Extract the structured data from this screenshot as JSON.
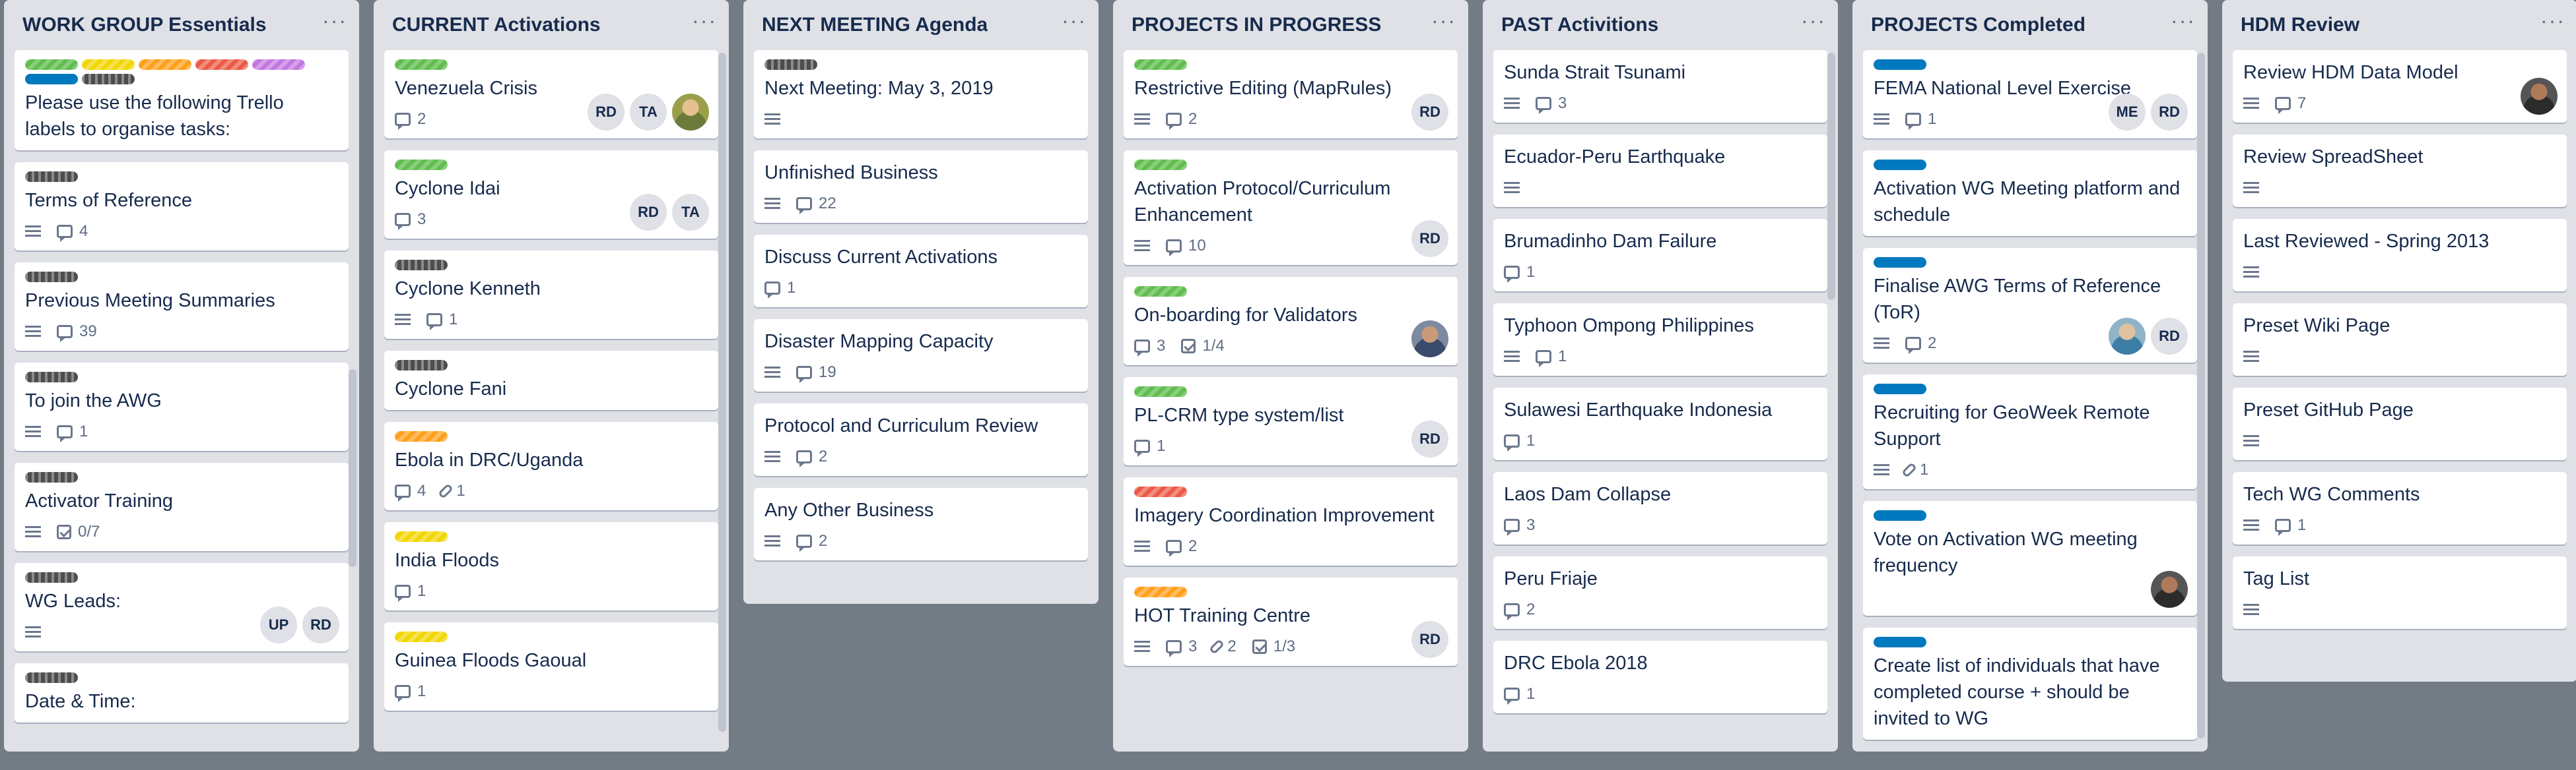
{
  "lists": [
    {
      "title": "WORK GROUP Essentials",
      "cards": [
        {
          "labels": [
            "green",
            "yellow",
            "orange",
            "red",
            "purple",
            "blue",
            "black"
          ],
          "title": "Please use the following Trello labels to organise tasks:",
          "badges": []
        },
        {
          "labels": [
            "black"
          ],
          "title": "Terms of Reference",
          "badges": [
            {
              "icon": "description-icon"
            },
            {
              "icon": "comment-icon",
              "text": "4"
            }
          ]
        },
        {
          "labels": [
            "black"
          ],
          "title": "Previous Meeting Summaries",
          "badges": [
            {
              "icon": "description-icon"
            },
            {
              "icon": "comment-icon",
              "text": "39"
            }
          ]
        },
        {
          "labels": [
            "black"
          ],
          "title": "To join the AWG",
          "badges": [
            {
              "icon": "description-icon"
            },
            {
              "icon": "comment-icon",
              "text": "1"
            }
          ]
        },
        {
          "labels": [
            "black"
          ],
          "title": "Activator Training",
          "badges": [
            {
              "icon": "description-icon"
            },
            {
              "icon": "checklist-icon",
              "text": "0/7"
            }
          ]
        },
        {
          "labels": [
            "black"
          ],
          "title": "WG Leads:",
          "badges": [
            {
              "icon": "description-icon"
            }
          ],
          "members": [
            "UP",
            "RD"
          ]
        },
        {
          "labels": [
            "black"
          ],
          "title": "Date & Time:",
          "badges": []
        }
      ]
    },
    {
      "title": "CURRENT Activations",
      "cards": [
        {
          "labels": [
            "green"
          ],
          "title": "Venezuela Crisis",
          "badges": [
            {
              "icon": "comment-icon",
              "text": "2"
            }
          ],
          "members": [
            "RD",
            "TA",
            "photo"
          ]
        },
        {
          "labels": [
            "green"
          ],
          "title": "Cyclone Idai",
          "badges": [
            {
              "icon": "comment-icon",
              "text": "3"
            }
          ],
          "members": [
            "RD",
            "TA"
          ]
        },
        {
          "labels": [
            "black"
          ],
          "title": "Cyclone Kenneth",
          "badges": [
            {
              "icon": "description-icon"
            },
            {
              "icon": "comment-icon",
              "text": "1"
            }
          ]
        },
        {
          "labels": [
            "black"
          ],
          "title": "Cyclone Fani",
          "badges": []
        },
        {
          "labels": [
            "orange"
          ],
          "title": "Ebola in DRC/Uganda",
          "badges": [
            {
              "icon": "comment-icon",
              "text": "4"
            },
            {
              "icon": "attachment-icon",
              "text": "1"
            }
          ]
        },
        {
          "labels": [
            "yellow"
          ],
          "title": "India Floods",
          "badges": [
            {
              "icon": "comment-icon",
              "text": "1"
            }
          ]
        },
        {
          "labels": [
            "yellow"
          ],
          "title": "Guinea Floods Gaoual",
          "badges": [
            {
              "icon": "comment-icon",
              "text": "1"
            }
          ]
        }
      ]
    },
    {
      "title": "NEXT MEETING Agenda",
      "cards": [
        {
          "labels": [
            "black"
          ],
          "title": "Next Meeting: May 3, 2019",
          "badges": [
            {
              "icon": "description-icon"
            }
          ]
        },
        {
          "labels": [],
          "title": "Unfinished Business",
          "badges": [
            {
              "icon": "description-icon"
            },
            {
              "icon": "comment-icon",
              "text": "22"
            }
          ]
        },
        {
          "labels": [],
          "title": "Discuss Current Activations",
          "badges": [
            {
              "icon": "comment-icon",
              "text": "1"
            }
          ]
        },
        {
          "labels": [],
          "title": "Disaster Mapping Capacity",
          "badges": [
            {
              "icon": "description-icon"
            },
            {
              "icon": "comment-icon",
              "text": "19"
            }
          ]
        },
        {
          "labels": [],
          "title": "Protocol and Curriculum Review",
          "badges": [
            {
              "icon": "description-icon"
            },
            {
              "icon": "comment-icon",
              "text": "2"
            }
          ]
        },
        {
          "labels": [],
          "title": "Any Other Business",
          "badges": [
            {
              "icon": "description-icon"
            },
            {
              "icon": "comment-icon",
              "text": "2"
            }
          ]
        }
      ]
    },
    {
      "title": "PROJECTS IN PROGRESS",
      "cards": [
        {
          "labels": [
            "green"
          ],
          "title": "Restrictive Editing (MapRules)",
          "badges": [
            {
              "icon": "description-icon"
            },
            {
              "icon": "comment-icon",
              "text": "2"
            }
          ],
          "members": [
            "RD"
          ]
        },
        {
          "labels": [
            "green"
          ],
          "title": "Activation Protocol/Curriculum Enhancement",
          "badges": [
            {
              "icon": "description-icon"
            },
            {
              "icon": "comment-icon",
              "text": "10"
            }
          ],
          "members": [
            "RD"
          ]
        },
        {
          "labels": [
            "green"
          ],
          "title": "On-boarding for Validators",
          "badges": [
            {
              "icon": "comment-icon",
              "text": "3"
            },
            {
              "icon": "checklist-icon",
              "text": "1/4"
            }
          ],
          "members": [
            "photo2"
          ]
        },
        {
          "labels": [
            "green"
          ],
          "title": "PL-CRM type system/list",
          "badges": [
            {
              "icon": "comment-icon",
              "text": "1"
            }
          ],
          "members": [
            "RD"
          ]
        },
        {
          "labels": [
            "red"
          ],
          "title": "Imagery Coordination Improvement",
          "badges": [
            {
              "icon": "description-icon"
            },
            {
              "icon": "comment-icon",
              "text": "2"
            }
          ]
        },
        {
          "labels": [
            "orange"
          ],
          "title": "HOT Training Centre",
          "badges": [
            {
              "icon": "description-icon"
            },
            {
              "icon": "comment-icon",
              "text": "3"
            },
            {
              "icon": "attachment-icon",
              "text": "2"
            },
            {
              "icon": "checklist-icon",
              "text": "1/3"
            }
          ],
          "members": [
            "RD"
          ]
        }
      ]
    },
    {
      "title": "PAST Activitions",
      "cards": [
        {
          "labels": [],
          "title": "Sunda Strait Tsunami",
          "badges": [
            {
              "icon": "description-icon"
            },
            {
              "icon": "comment-icon",
              "text": "3"
            }
          ]
        },
        {
          "labels": [],
          "title": "Ecuador-Peru Earthquake",
          "badges": [
            {
              "icon": "description-icon"
            }
          ]
        },
        {
          "labels": [],
          "title": "Brumadinho Dam Failure",
          "badges": [
            {
              "icon": "comment-icon",
              "text": "1"
            }
          ]
        },
        {
          "labels": [],
          "title": "Typhoon Ompong Philippines",
          "badges": [
            {
              "icon": "description-icon"
            },
            {
              "icon": "comment-icon",
              "text": "1"
            }
          ]
        },
        {
          "labels": [],
          "title": "Sulawesi Earthquake Indonesia",
          "badges": [
            {
              "icon": "comment-icon",
              "text": "1"
            }
          ]
        },
        {
          "labels": [],
          "title": "Laos Dam Collapse",
          "badges": [
            {
              "icon": "comment-icon",
              "text": "3"
            }
          ]
        },
        {
          "labels": [],
          "title": "Peru Friaje",
          "badges": [
            {
              "icon": "comment-icon",
              "text": "2"
            }
          ]
        },
        {
          "labels": [],
          "title": "DRC Ebola 2018",
          "badges": [
            {
              "icon": "comment-icon",
              "text": "1"
            }
          ]
        }
      ]
    },
    {
      "title": "PROJECTS Completed",
      "cards": [
        {
          "labels": [
            "blue"
          ],
          "title": "FEMA National Level Exercise",
          "badges": [
            {
              "icon": "description-icon"
            },
            {
              "icon": "comment-icon",
              "text": "1"
            }
          ],
          "members": [
            "ME",
            "RD"
          ]
        },
        {
          "labels": [
            "blue"
          ],
          "title": "Activation WG Meeting platform and schedule",
          "badges": []
        },
        {
          "labels": [
            "blue"
          ],
          "title": "Finalise AWG Terms of Reference (ToR)",
          "badges": [
            {
              "icon": "description-icon"
            },
            {
              "icon": "comment-icon",
              "text": "2"
            }
          ],
          "members": [
            "photo4",
            "RD"
          ]
        },
        {
          "labels": [
            "blue"
          ],
          "title": "Recruiting for GeoWeek Remote Support",
          "badges": [
            {
              "icon": "description-icon"
            },
            {
              "icon": "attachment-icon",
              "text": "1"
            }
          ]
        },
        {
          "labels": [
            "blue"
          ],
          "title": "Vote on Activation WG meeting frequency",
          "badges": [],
          "members": [
            "photo3"
          ]
        },
        {
          "labels": [
            "blue"
          ],
          "title": "Create list of individuals that have completed course + should be invited to WG",
          "badges": []
        }
      ]
    },
    {
      "title": "HDM Review",
      "cards": [
        {
          "labels": [],
          "title": "Review HDM Data Model",
          "badges": [
            {
              "icon": "description-icon"
            },
            {
              "icon": "comment-icon",
              "text": "7"
            }
          ],
          "members": [
            "photo3"
          ]
        },
        {
          "labels": [],
          "title": "Review SpreadSheet",
          "badges": [
            {
              "icon": "description-icon"
            }
          ]
        },
        {
          "labels": [],
          "title": "Last Reviewed - Spring 2013",
          "badges": [
            {
              "icon": "description-icon"
            }
          ]
        },
        {
          "labels": [],
          "title": "Preset Wiki Page",
          "badges": [
            {
              "icon": "description-icon"
            }
          ]
        },
        {
          "labels": [],
          "title": "Preset GitHub Page",
          "badges": [
            {
              "icon": "description-icon"
            }
          ]
        },
        {
          "labels": [],
          "title": "Tech WG Comments",
          "badges": [
            {
              "icon": "description-icon"
            },
            {
              "icon": "comment-icon",
              "text": "1"
            }
          ]
        },
        {
          "labels": [],
          "title": "Tag List",
          "badges": [
            {
              "icon": "description-icon"
            }
          ]
        }
      ]
    }
  ],
  "list_menu_glyph": "···"
}
